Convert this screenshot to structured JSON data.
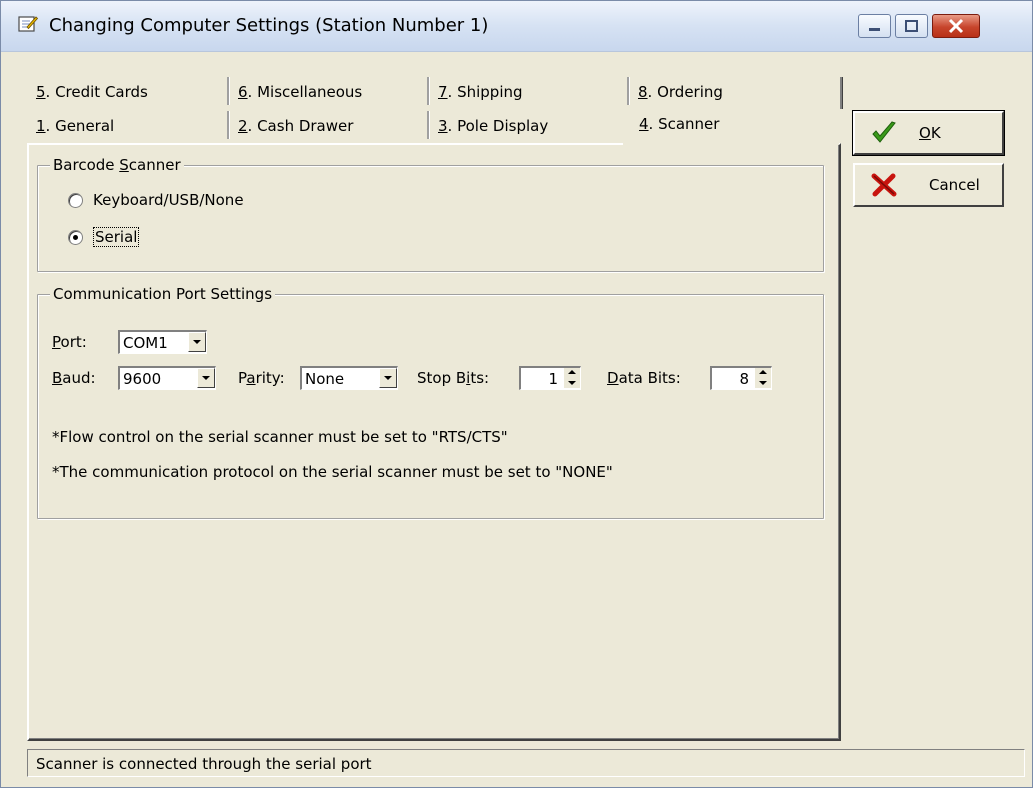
{
  "window": {
    "title": "Changing Computer Settings  (Station Number 1)"
  },
  "tabs": {
    "row1": [
      {
        "num": "5",
        "label": ". Credit Cards"
      },
      {
        "num": "6",
        "label": ". Miscellaneous"
      },
      {
        "num": "7",
        "label": ". Shipping"
      },
      {
        "num": "8",
        "label": ". Ordering"
      }
    ],
    "row2": [
      {
        "num": "1",
        "label": ". General"
      },
      {
        "num": "2",
        "label": ". Cash Drawer"
      },
      {
        "num": "3",
        "label": ". Pole Display"
      },
      {
        "num": "4",
        "label": ". Scanner"
      }
    ],
    "active": "4. Scanner"
  },
  "barcode": {
    "group_label_pre": "Barcode ",
    "group_label_key": "S",
    "group_label_post": "canner",
    "options": [
      {
        "label": "Keyboard/USB/None",
        "checked": false
      },
      {
        "label": "Serial",
        "checked": true
      }
    ]
  },
  "comm": {
    "group_label": "Communication Port Settings",
    "port_label_key": "P",
    "port_label_rest": "ort:",
    "port_value": "COM1",
    "baud_label_key": "B",
    "baud_label_rest": "aud:",
    "baud_value": "9600",
    "parity_label_pre": "P",
    "parity_label_key": "a",
    "parity_label_rest": "rity:",
    "parity_value": "None",
    "stop_label_pre": "Stop B",
    "stop_label_key": "i",
    "stop_label_rest": "ts:",
    "stop_value": "1",
    "data_label_key": "D",
    "data_label_rest": "ata Bits:",
    "data_value": "8",
    "note1": "*Flow control on the serial scanner must be set to \"RTS/CTS\"",
    "note2": "*The communication protocol on the serial scanner must be set to \"NONE\""
  },
  "buttons": {
    "ok_key": "O",
    "ok_rest": "K",
    "cancel": "Cancel"
  },
  "status": {
    "text": "Scanner is connected through the serial port"
  }
}
